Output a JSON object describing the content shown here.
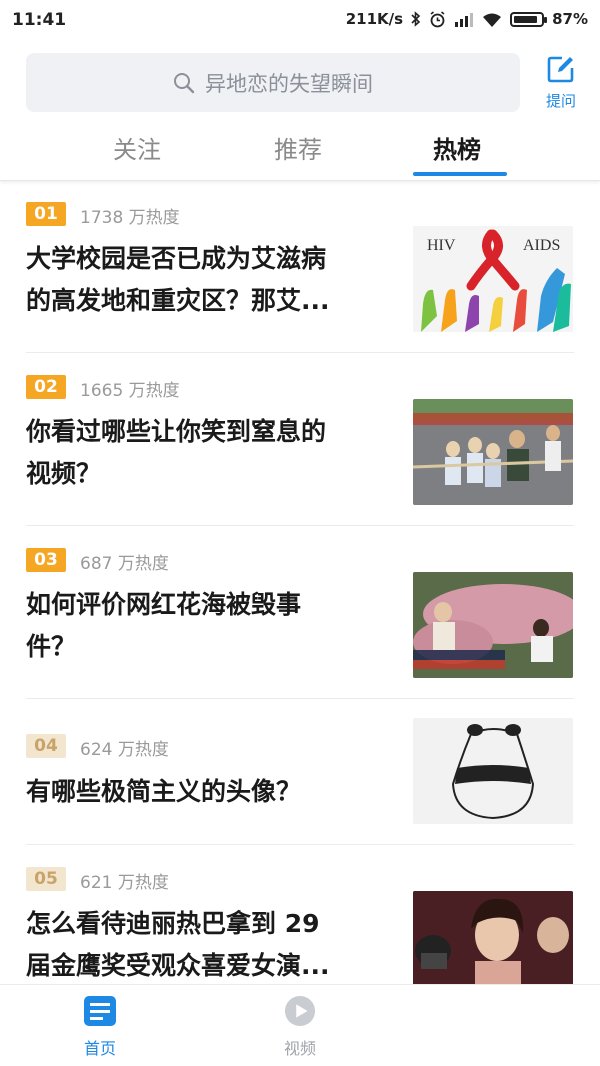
{
  "status": {
    "time": "11:41",
    "speed": "211K/s",
    "battery": "87%",
    "battery_level": 0.87
  },
  "search": {
    "placeholder": "异地恋的失望瞬间"
  },
  "header": {
    "ask_label": "提问"
  },
  "tabs": [
    {
      "label": "关注",
      "active": false
    },
    {
      "label": "推荐",
      "active": false
    },
    {
      "label": "热榜",
      "active": true
    }
  ],
  "hot_list": [
    {
      "rank": "01",
      "heat": "1738 万热度",
      "title_lines": [
        "大学校园是否已成为艾滋病",
        "的高发地和重灾区？那艾..."
      ],
      "thumb": {
        "texts": [
          "HIV",
          "AIDS"
        ]
      }
    },
    {
      "rank": "02",
      "heat": "1665 万热度",
      "title_lines": [
        "你看过哪些让你笑到窒息的",
        "视频？"
      ]
    },
    {
      "rank": "03",
      "heat": "687 万热度",
      "title_lines": [
        "如何评价网红花海被毁事",
        "件？"
      ]
    },
    {
      "rank": "04",
      "heat": "624 万热度",
      "title_lines": [
        "有哪些极简主义的头像？"
      ]
    },
    {
      "rank": "05",
      "heat": "621 万热度",
      "title_lines": [
        "怎么看待迪丽热巴拿到 29",
        "届金鹰奖受观众喜爱女演..."
      ]
    }
  ],
  "bottom_nav": [
    {
      "label": "首页",
      "active": true
    },
    {
      "label": "视频",
      "active": false
    }
  ],
  "colors": {
    "accent": "#1e88e5",
    "rank_top": "#f5a623",
    "rank_other": "#f2e6cf",
    "rank_other_text": "#c9a46a"
  }
}
